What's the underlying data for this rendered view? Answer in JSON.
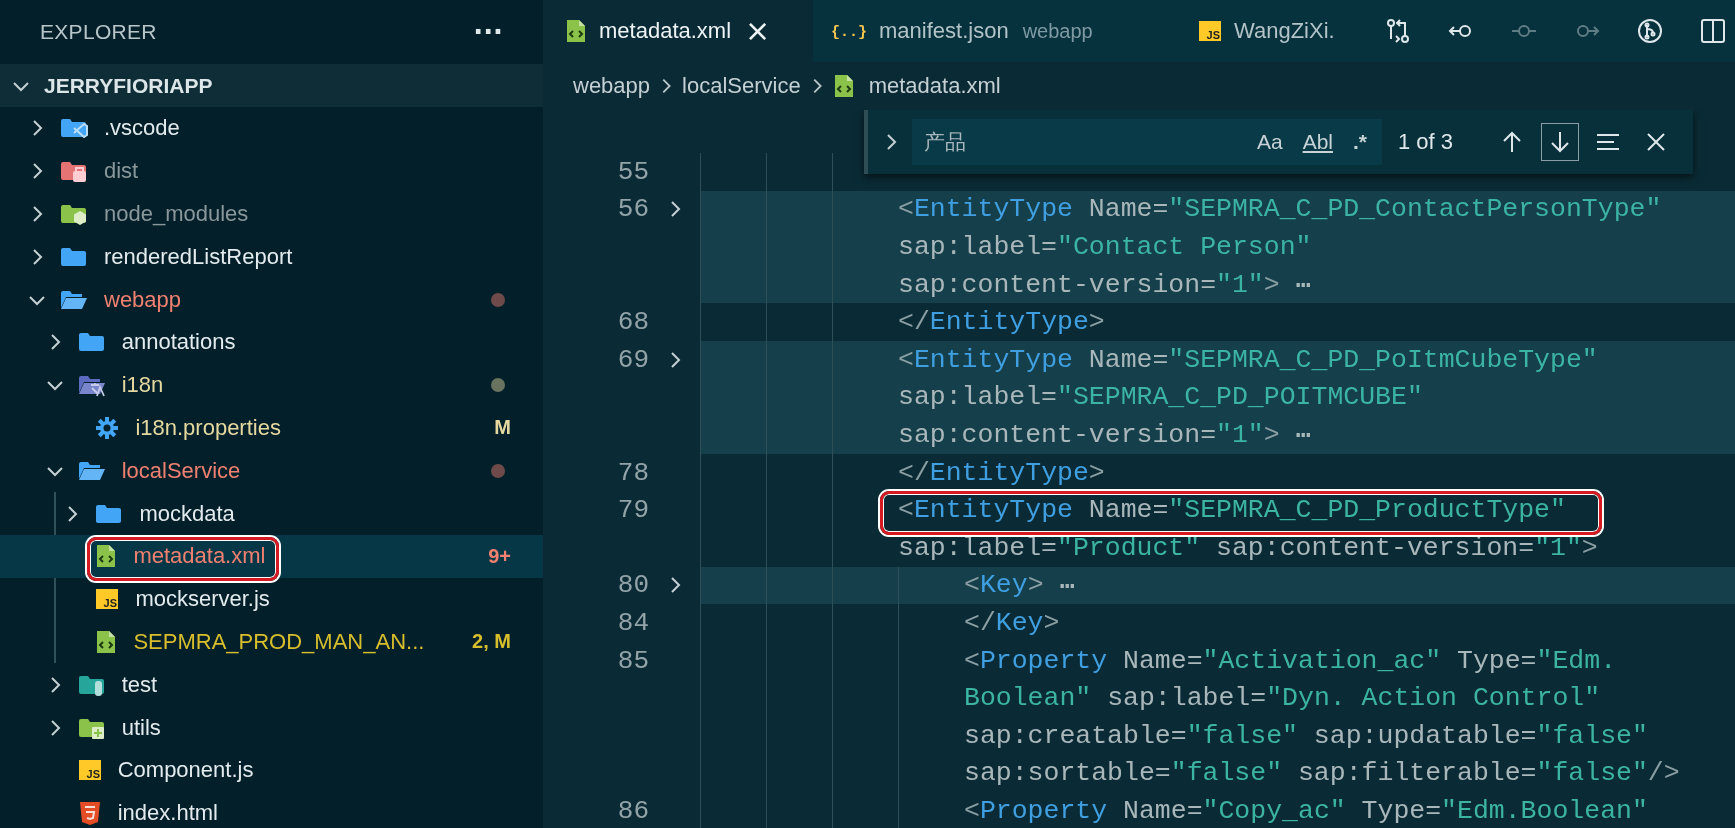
{
  "sidebar": {
    "title": "EXPLORER",
    "more": "···",
    "root": {
      "label": "JERRYFIORIAPP",
      "expanded": true,
      "children": [
        {
          "label": ".vscode",
          "kind": "vscode",
          "expanded": false,
          "selected": false,
          "color": "#e4ebee"
        },
        {
          "label": "dist",
          "kind": "dist",
          "expanded": false,
          "selected": false,
          "color": "#8a979b"
        },
        {
          "label": "node_modules",
          "kind": "node",
          "expanded": false,
          "selected": false,
          "color": "#8a979b"
        },
        {
          "label": "renderedListReport",
          "kind": "folder",
          "expanded": false,
          "selected": false,
          "color": "#e4ebee"
        },
        {
          "label": "webapp",
          "kind": "folder",
          "expanded": true,
          "selected": false,
          "color": "#f08070",
          "dot": true,
          "children": [
            {
              "label": "annotations",
              "kind": "folder",
              "expanded": false,
              "selected": false,
              "color": "#e4ebee"
            },
            {
              "label": "i18n",
              "kind": "i18n",
              "expanded": true,
              "selected": false,
              "color": "#e6d9a0",
              "dot": true,
              "children": [
                {
                  "label": "i18n.properties",
                  "kind": "settings",
                  "selected": false,
                  "color": "#e6d9a0",
                  "badge": "M"
                }
              ]
            },
            {
              "label": "localService",
              "kind": "folder",
              "expanded": true,
              "selected": false,
              "color": "#f08070",
              "dot": true,
              "children": [
                {
                  "label": "mockdata",
                  "kind": "folder",
                  "expanded": false,
                  "selected": false,
                  "color": "#e4ebee"
                },
                {
                  "label": "metadata.xml",
                  "kind": "xml",
                  "selected": true,
                  "color": "#f08070",
                  "badge": "9+",
                  "annotated": true
                },
                {
                  "label": "mockserver.js",
                  "kind": "js",
                  "icon_text": "JS",
                  "selected": false,
                  "color": "#e4ebee"
                },
                {
                  "label": "SEPMRA_PROD_MAN_AN...",
                  "kind": "xml",
                  "selected": false,
                  "color": "#d8be2c",
                  "badge": "2, M"
                }
              ]
            },
            {
              "label": "test",
              "kind": "test",
              "expanded": false,
              "selected": false,
              "color": "#e4ebee"
            },
            {
              "label": "utils",
              "kind": "utils",
              "expanded": false,
              "selected": false,
              "color": "#e4ebee"
            },
            {
              "label": "Component.js",
              "kind": "js",
              "icon_text": "JS",
              "selected": false,
              "color": "#e4ebee"
            },
            {
              "label": "index.html",
              "kind": "html",
              "selected": false,
              "color": "#e4ebee"
            }
          ]
        }
      ]
    }
  },
  "tabs": [
    {
      "label": "metadata.xml",
      "kind": "xml",
      "selected": true,
      "close": "×"
    },
    {
      "label": "manifest.json",
      "kind": "json",
      "icon_text": "{..}",
      "description": "webapp",
      "selected": false
    },
    {
      "label": "WangZiXi.",
      "kind": "js",
      "icon_text": "JS",
      "selected": false
    }
  ],
  "toolbar": [
    {
      "disabled": false
    },
    {
      "disabled": false
    },
    {
      "disabled": true
    },
    {
      "disabled": true
    },
    {
      "disabled": false
    },
    {
      "disabled": false
    }
  ],
  "breadcrumb": [
    {
      "label": "webapp",
      "kind": "folder"
    },
    {
      "label": "localService",
      "kind": "folder"
    },
    {
      "label": "metadata.xml",
      "kind": "xml"
    }
  ],
  "find": {
    "value": "产品",
    "toggles": [
      {
        "label": "Aa",
        "kind": "case",
        "on": false
      },
      {
        "label": "Abl",
        "kind": "word",
        "on": false
      },
      {
        "label": ".*",
        "kind": "regex",
        "on": false
      }
    ],
    "result": "1 of 3",
    "buttons": [
      {
        "focused": false
      },
      {
        "focused": true
      },
      {
        "focused": false
      },
      {
        "focused": false
      }
    ]
  },
  "code": [
    {
      "number": "55",
      "folded": false
    },
    {
      "number": "56",
      "folded": true,
      "rows": [
        "<EntityType Name=\"SEPMRA_C_PD_ContactPersonType\"",
        "sap:label=\"Contact Person\"",
        "sap:content-version=\"1\"> ⋯"
      ]
    },
    {
      "number": "68",
      "folded": false,
      "rows": [
        "</EntityType>"
      ]
    },
    {
      "number": "69",
      "folded": true,
      "rows": [
        "<EntityType Name=\"SEPMRA_C_PD_PoItmCubeType\"",
        "sap:label=\"SEPMRA_C_PD_POITMCUBE\"",
        "sap:content-version=\"1\"> ⋯"
      ]
    },
    {
      "number": "78",
      "folded": false,
      "rows": [
        "</EntityType>"
      ]
    },
    {
      "number": "79",
      "folded": false,
      "annotated": true,
      "rows": [
        "<EntityType Name=\"SEPMRA_C_PD_ProductType\"",
        "sap:label=\"Product\" sap:content-version=\"1\">"
      ],
      "children": [
        {
          "number": "80",
          "folded": true,
          "rows": [
            "<Key> ⋯"
          ]
        },
        {
          "number": "84",
          "folded": false,
          "rows": [
            "</Key>"
          ]
        },
        {
          "number": "85",
          "folded": false,
          "rows": [
            "<Property Name=\"Activation_ac\" Type=\"Edm.",
            "Boolean\" sap:label=\"Dyn. Action Control\"",
            "sap:creatable=\"false\" sap:updatable=\"false\"",
            "sap:sortable=\"false\" sap:filterable=\"false\"/>"
          ]
        },
        {
          "number": "86",
          "folded": false,
          "rows": [
            "<Property Name=\"Copy_ac\" Type=\"Edm.Boolean\""
          ]
        }
      ]
    }
  ]
}
